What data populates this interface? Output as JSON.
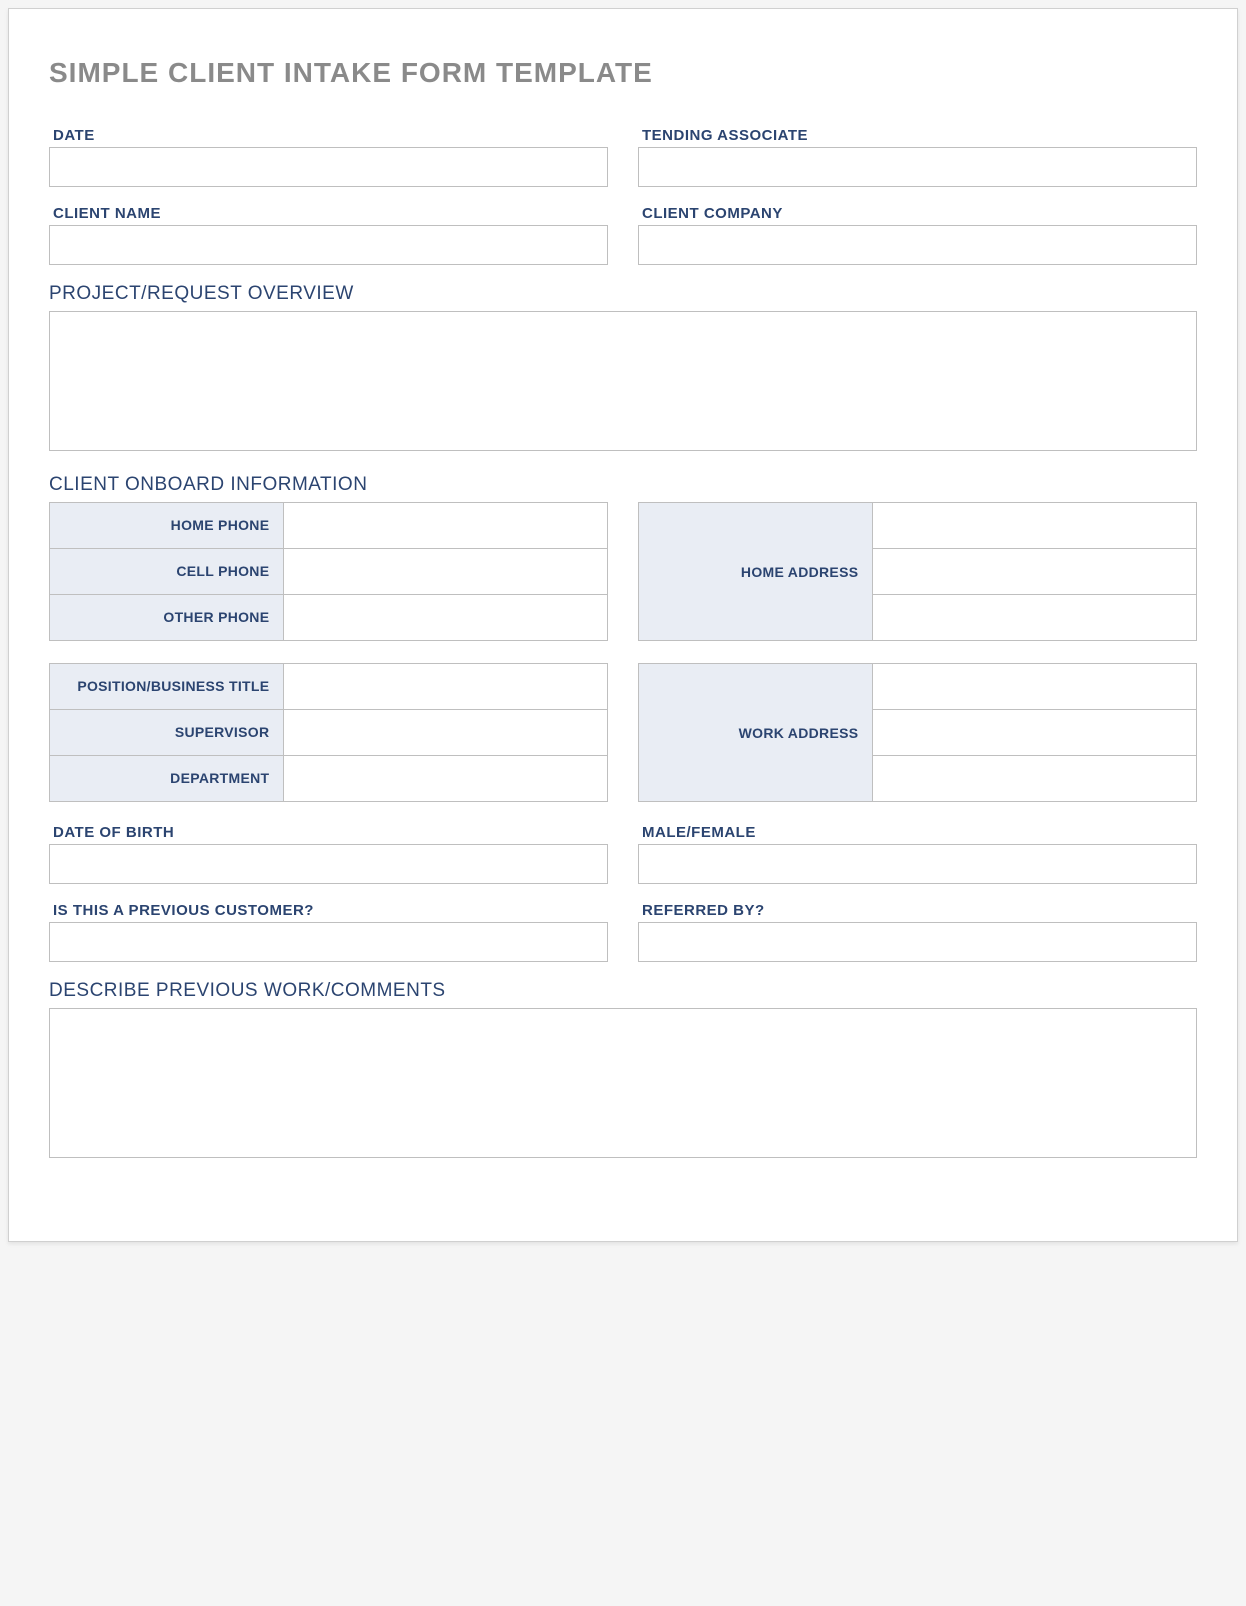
{
  "title": "SIMPLE CLIENT INTAKE FORM TEMPLATE",
  "top": {
    "date_label": "DATE",
    "date_value": "",
    "associate_label": "TENDING ASSOCIATE",
    "associate_value": "",
    "client_name_label": "CLIENT NAME",
    "client_name_value": "",
    "client_company_label": "CLIENT COMPANY",
    "client_company_value": ""
  },
  "project": {
    "overview_label": "PROJECT/REQUEST OVERVIEW",
    "overview_value": ""
  },
  "onboard": {
    "section_label": "CLIENT ONBOARD INFORMATION",
    "home_phone_label": "HOME PHONE",
    "home_phone_value": "",
    "cell_phone_label": "CELL PHONE",
    "cell_phone_value": "",
    "other_phone_label": "OTHER PHONE",
    "other_phone_value": "",
    "home_address_label": "HOME ADDRESS",
    "home_address_value1": "",
    "home_address_value2": "",
    "home_address_value3": "",
    "position_label": "POSITION/BUSINESS TITLE",
    "position_value": "",
    "supervisor_label": "SUPERVISOR",
    "supervisor_value": "",
    "department_label": "DEPARTMENT",
    "department_value": "",
    "work_address_label": "WORK ADDRESS",
    "work_address_value1": "",
    "work_address_value2": "",
    "work_address_value3": ""
  },
  "personal": {
    "dob_label": "DATE OF BIRTH",
    "dob_value": "",
    "gender_label": "MALE/FEMALE",
    "gender_value": "",
    "previous_customer_label": "IS THIS A PREVIOUS CUSTOMER?",
    "previous_customer_value": "",
    "referred_by_label": "REFERRED BY?",
    "referred_by_value": ""
  },
  "comments": {
    "label": "DESCRIBE PREVIOUS WORK/COMMENTS",
    "value": ""
  }
}
